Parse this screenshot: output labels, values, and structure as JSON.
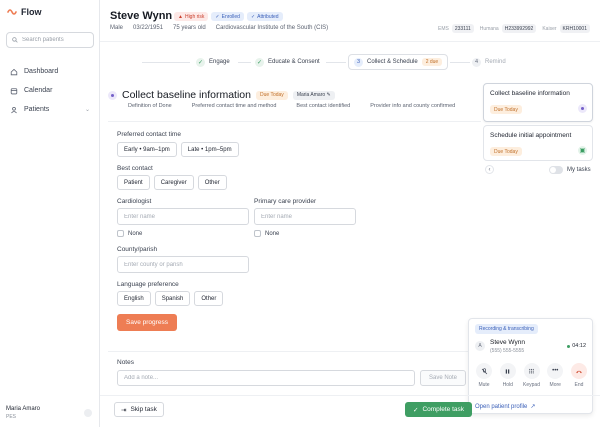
{
  "app": {
    "name": "Flow"
  },
  "sidebar": {
    "search_placeholder": "Search patients",
    "items": [
      {
        "label": "Dashboard",
        "icon": "home-icon"
      },
      {
        "label": "Calendar",
        "icon": "calendar-icon"
      },
      {
        "label": "Patients",
        "icon": "users-icon"
      }
    ],
    "user": {
      "name": "Maria Amaro",
      "role": "PES"
    }
  },
  "patient": {
    "name": "Steve Wynn",
    "badges": [
      {
        "label": "High risk",
        "color": "red"
      },
      {
        "label": "Enrolled",
        "color": "blue"
      },
      {
        "label": "Attributed",
        "color": "blue"
      }
    ],
    "sex": "Male",
    "dob": "03/22/1951",
    "age": "75 years old",
    "institute": "Cardiovascular Institute of the South (CIS)",
    "ids": [
      {
        "label": "EMS",
        "value": "233111"
      },
      {
        "label": "Humana",
        "value": "H233992992"
      },
      {
        "label": "Kaiser",
        "value": "KRH10001"
      }
    ]
  },
  "stepper": {
    "steps": [
      {
        "label": "Engage",
        "state": "done"
      },
      {
        "label": "Educate & Consent",
        "state": "done"
      },
      {
        "num": "3",
        "label": "Collect & Schedule",
        "state": "active",
        "pill": "2 due"
      },
      {
        "num": "4",
        "label": "Remind",
        "state": "disabled"
      }
    ]
  },
  "task": {
    "title": "Collect baseline information",
    "due": "Due Today",
    "assignee": "Maria Amaro",
    "sub": [
      "Definition of Done",
      "Preferred contact time and method",
      "Best contact identified",
      "Provider info and county confirmed"
    ]
  },
  "form": {
    "contact_time": {
      "label": "Preferred contact time",
      "options": [
        "Early • 9am–1pm",
        "Late • 1pm–5pm"
      ]
    },
    "best_contact": {
      "label": "Best contact",
      "options": [
        "Patient",
        "Caregiver",
        "Other"
      ]
    },
    "cardiologist": {
      "label": "Cardiologist",
      "placeholder": "Enter name",
      "none_label": "None"
    },
    "pcp": {
      "label": "Primary care provider",
      "placeholder": "Enter name",
      "none_label": "None"
    },
    "county": {
      "label": "County/parish",
      "placeholder": "Enter county or parish"
    },
    "language": {
      "label": "Language preference",
      "options": [
        "English",
        "Spanish",
        "Other"
      ]
    },
    "save_label": "Save progress"
  },
  "notes": {
    "label": "Notes",
    "placeholder": "Add a note...",
    "save_label": "Save Note"
  },
  "footer": {
    "skip_label": "Skip task",
    "complete_label": "Complete task"
  },
  "task_list": {
    "cards": [
      {
        "title": "Collect baseline information",
        "due": "Due Today"
      },
      {
        "title": "Schedule initial appointment",
        "due": "Due Today"
      }
    ],
    "toggle_label": "My tasks"
  },
  "call": {
    "status": "Recording & transcribing",
    "avatar_letter": "A",
    "name": "Steve Wynn",
    "phone": "(555) 555-5555",
    "timer": "04:12",
    "actions": [
      "Mute",
      "Hold",
      "Keypad",
      "More",
      "End"
    ],
    "profile_link": "Open patient profile"
  }
}
